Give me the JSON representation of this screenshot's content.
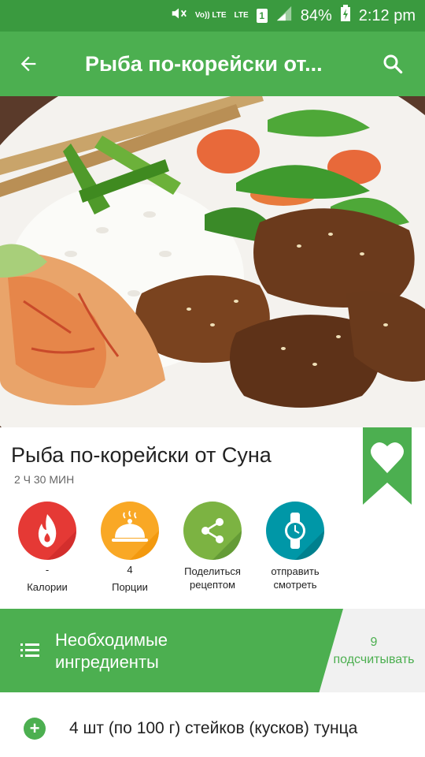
{
  "status": {
    "volte": "Vo)) LTE",
    "lte": "LTE",
    "sim": "1",
    "battery": "84%",
    "time": "2:12 pm"
  },
  "appbar": {
    "title": "Рыба по-корейски от...",
    "back_icon": "arrow-left-icon",
    "search_icon": "search-icon",
    "color": "#4caf50"
  },
  "recipe": {
    "title": "Рыба по-корейски от Суна",
    "time": "2 Ч 30 МИН",
    "bookmark_icon": "heart-icon"
  },
  "actions": [
    {
      "value": "-",
      "label": "Калории",
      "icon": "calorie-flame-icon",
      "color": "#e53935"
    },
    {
      "value": "4",
      "label": "Порции",
      "icon": "serving-cloche-icon",
      "color": "#f9a825"
    },
    {
      "label_line1": "Поделиться",
      "label_line2": "рецептом",
      "icon": "share-icon",
      "color": "#7cb342"
    },
    {
      "label_line1": "отправить",
      "label_line2": "смотреть",
      "icon": "smartwatch-icon",
      "color": "#0097a7"
    }
  ],
  "ingredients": {
    "title_line1": "Необходимые",
    "title_line2": "ингредиенты",
    "count": "9",
    "count_label": "подсчитывать",
    "items": [
      {
        "text": "4 шт (по 100 г) стейков (кусков) тунца"
      }
    ]
  }
}
